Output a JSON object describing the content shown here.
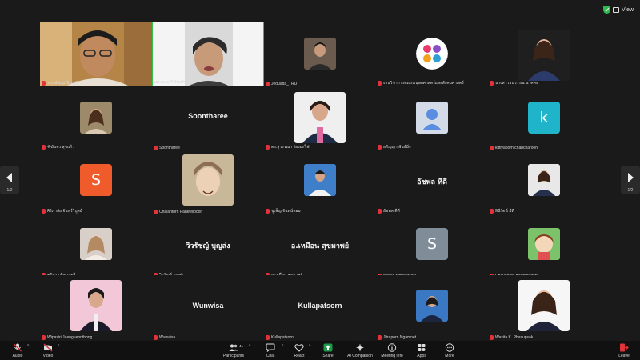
{
  "topbar": {
    "view_label": "View"
  },
  "pagination": {
    "left_page": "1/2",
    "right_page": "1/2"
  },
  "tiles": [
    "นายพัชญะ ปิ่นมณี",
    "ผศ.ดร.อรวี จันทร์ทองสุข",
    "Jeduada_TRU",
    "งานวิชาการคณะมนุษยศาสตร์และสังคมศาสตร์",
    "นางสาวธนวรรณ นาคคง",
    "ฑิฆัมพร สุขแก้ว",
    "Soontharee",
    "ดร.สุวรรณา ร่องมะไฟ",
    "อภิญญา พันธ์มิ่ง",
    "kittiyaporn chancharoen",
    "ศิริภาลัย จันทร์วิบูลย์",
    "Chalantorn Pankwilpoon",
    "ชูเพ็ญ จันทน์หอม",
    "อัชพล ทีดี",
    "สินีรัตน์ มีดี",
    "ศุภิสรา ศิลมนตรี",
    "วิวรัชญ์ บุญส่ง",
    "อ.เหมือน สุขมาพย์",
    "sunisa tamnawwai",
    "Chayanoot Boonpraitate",
    "Wipasiri Jaenguennthong",
    "Wunwisa",
    "Kullapatsorn",
    "Jitraporn Ngamnet",
    "Wasita K. Phasupsak"
  ],
  "center_names": {
    "soontharee": "Soontharee",
    "atchaphon": "อัชพล ทีดี",
    "wiwatchay": "วิวรัชญ์ บุญส่ง",
    "muean": "อ.เหมือน สุขมาพย์",
    "wunwisa": "Wunwisa",
    "kullapatsorn": "Kullapatsorn"
  },
  "avatar_letters": {
    "s1": "S",
    "k": "k",
    "s2": "S"
  },
  "toolbar": {
    "audio": "Audio",
    "video": "Video",
    "participants": "Participants",
    "participants_count": "41",
    "chat": "Chat",
    "react": "React",
    "share": "Share",
    "ai_companion": "AI Companion",
    "meeting_info": "Meeting info",
    "apps": "Apps",
    "more": "More",
    "leave": "Leave"
  },
  "colors": {
    "background": "#1a1a1a",
    "active_speaker": "#35c24b",
    "muted": "#e0333a",
    "share": "#1f9a4a"
  }
}
